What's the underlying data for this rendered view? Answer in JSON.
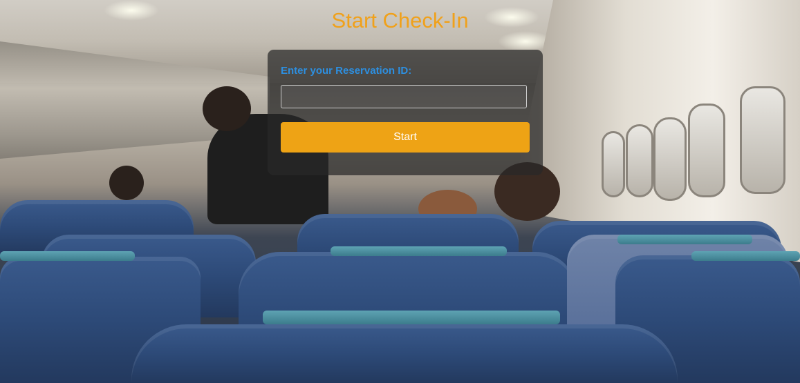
{
  "page": {
    "title": "Start Check-In"
  },
  "form": {
    "reservation_label": "Enter your Reservation ID:",
    "reservation_value": "",
    "reservation_placeholder": "",
    "start_button_label": "Start"
  },
  "colors": {
    "title": "#f0a11b",
    "label": "#2d8fe0",
    "button": "#eea315"
  },
  "background": {
    "description_icon": "airplane-cabin-photo"
  }
}
